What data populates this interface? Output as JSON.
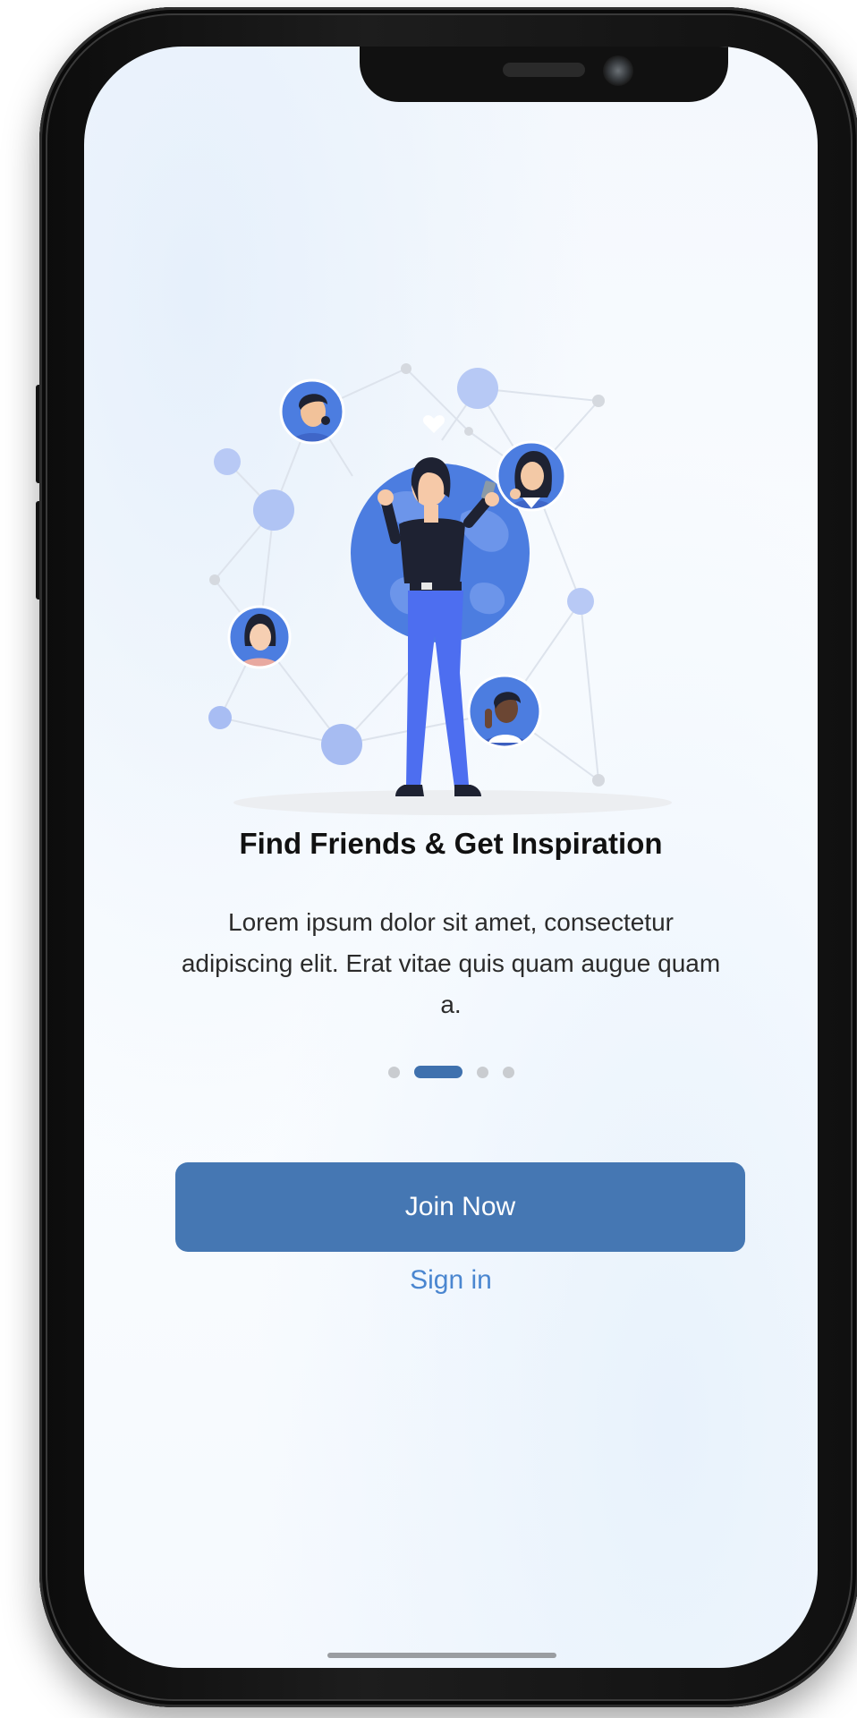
{
  "onboarding": {
    "title": "Find Friends & Get Inspiration",
    "description": "Lorem ipsum dolor sit amet, consectetur adipiscing elit. Erat vitae quis quam augue quam a.",
    "page_indicator": {
      "total_pages": 4,
      "active_page": 2
    }
  },
  "actions": {
    "join_label": "Join Now",
    "signin_label": "Sign in"
  },
  "colors": {
    "primary_button": "#4577b3",
    "link": "#4a86d0",
    "illustration_blue": "#4a7be0",
    "title_text": "#111111"
  },
  "icons": {
    "illustration": "social-network-illustration",
    "heart": "heart-icon"
  }
}
